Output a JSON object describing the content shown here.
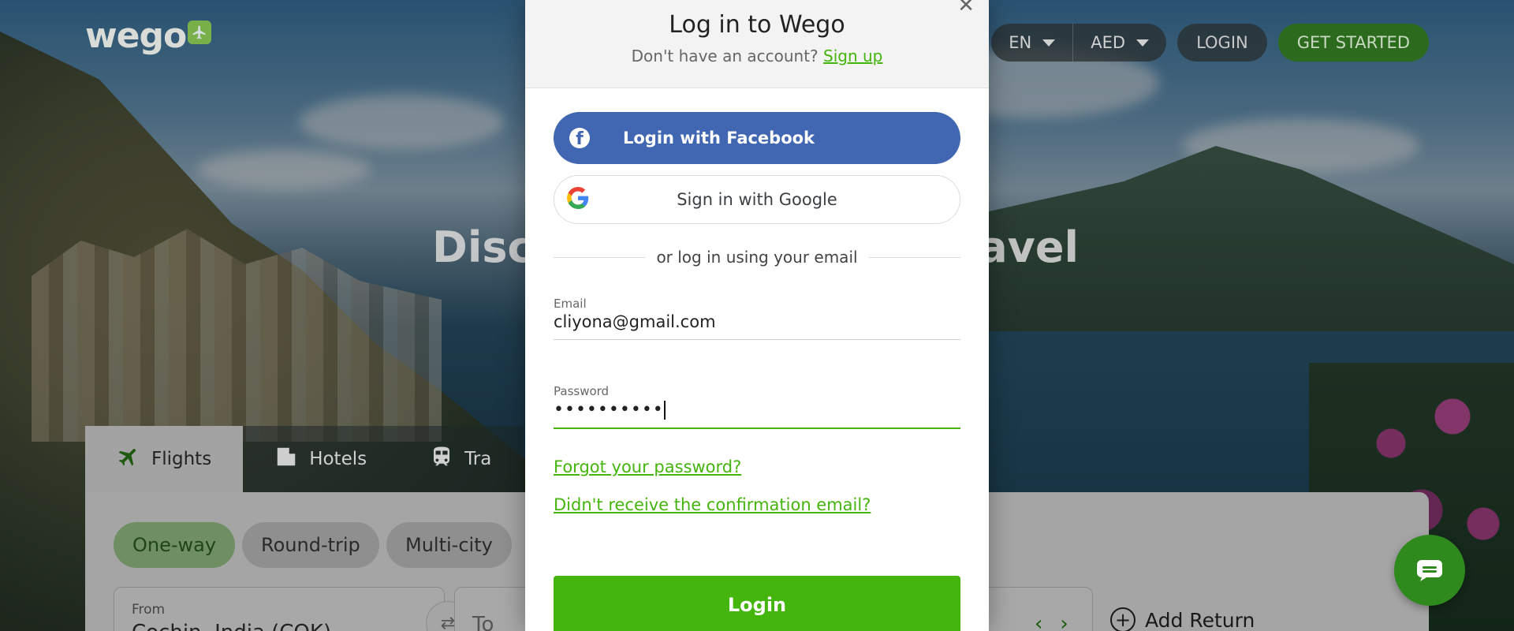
{
  "header": {
    "logo_text": "wego",
    "language": "EN",
    "currency": "AED",
    "login_label": "LOGIN",
    "get_started_label": "GET STARTED"
  },
  "hero": {
    "title_left": "Disc",
    "title_right": "ravel"
  },
  "search": {
    "tabs": [
      {
        "label": "Flights",
        "icon": "plane-icon"
      },
      {
        "label": "Hotels",
        "icon": "hotel-icon"
      },
      {
        "label": "Tra",
        "icon": "train-icon"
      }
    ],
    "trip_types": [
      "One-way",
      "Round-trip",
      "Multi-city"
    ],
    "from_label": "From",
    "from_value": "Cochin, India (COK)",
    "to_placeholder": "To",
    "add_return": "Add Return"
  },
  "modal": {
    "title": "Log in to Wego",
    "no_account": "Don't have an account?",
    "signup": "Sign up",
    "facebook_button": "Login with Facebook",
    "google_button": "Sign in with Google",
    "divider": "or log in using your email",
    "email_label": "Email",
    "email_value": "cliyona@gmail.com",
    "password_label": "Password",
    "password_value": "••••••••••",
    "forgot_password": "Forgot your password?",
    "resend_confirmation": "Didn't receive the confirmation email?",
    "login_button": "Login"
  },
  "colors": {
    "brand_green": "#44b50c",
    "facebook_blue": "#4267b2"
  }
}
